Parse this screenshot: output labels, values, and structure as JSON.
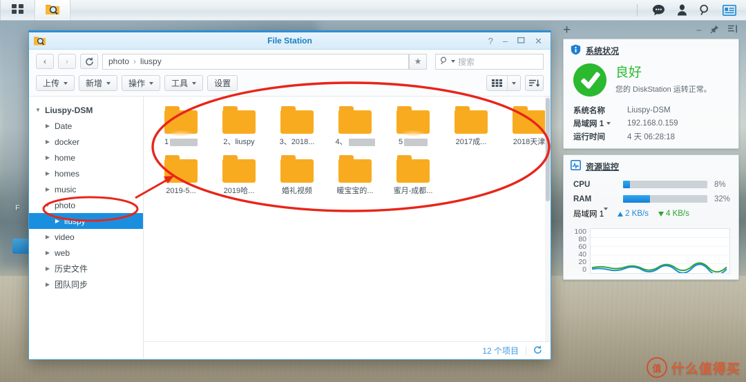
{
  "taskbar": {
    "apps": [
      {
        "name": "main-menu",
        "icon": "grid-menu-icon"
      },
      {
        "name": "file-station",
        "icon": "file-station-icon",
        "active": true
      }
    ],
    "tray": [
      {
        "name": "notifications",
        "icon": "chat-bubble-icon"
      },
      {
        "name": "user-options",
        "icon": "person-icon"
      },
      {
        "name": "search",
        "icon": "search-icon"
      },
      {
        "name": "widgets",
        "icon": "widget-panel-icon"
      }
    ]
  },
  "desktop": {
    "icon_label": "F"
  },
  "file_station": {
    "title": "File Station",
    "window_buttons": {
      "help": "?",
      "minimize": "–",
      "maximize": "❐",
      "close": "✕"
    },
    "nav": {
      "back": "‹",
      "forward": "›",
      "refresh": "⟳",
      "breadcrumb": [
        "photo",
        "liuspy"
      ],
      "breadcrumb_separator": "›",
      "favorite_icon": "star-icon"
    },
    "search": {
      "placeholder": "搜索",
      "value": "",
      "icon": "search-icon"
    },
    "toolbar": {
      "upload": "上传",
      "new": "新增",
      "action": "操作",
      "tools": "工具",
      "settings": "设置",
      "view_mode": "grid-view-icon",
      "view_dropdown": "chevron-down-icon",
      "sort": "sort-icon"
    },
    "tree": [
      {
        "label": "Liuspy-DSM",
        "level": 0,
        "expanded": true,
        "selected": false
      },
      {
        "label": "Date",
        "level": 1,
        "expanded": false,
        "selected": false
      },
      {
        "label": "docker",
        "level": 1,
        "expanded": false,
        "selected": false
      },
      {
        "label": "home",
        "level": 1,
        "expanded": false,
        "selected": false
      },
      {
        "label": "homes",
        "level": 1,
        "expanded": false,
        "selected": false
      },
      {
        "label": "music",
        "level": 1,
        "expanded": false,
        "selected": false
      },
      {
        "label": "photo",
        "level": 1,
        "expanded": true,
        "selected": false
      },
      {
        "label": "liuspy",
        "level": 2,
        "expanded": false,
        "selected": true
      },
      {
        "label": "video",
        "level": 1,
        "expanded": false,
        "selected": false
      },
      {
        "label": "web",
        "level": 1,
        "expanded": false,
        "selected": false
      },
      {
        "label": "历史文件",
        "level": 1,
        "expanded": false,
        "selected": false
      },
      {
        "label": "团队同步",
        "level": 1,
        "expanded": false,
        "selected": false
      }
    ],
    "items": [
      {
        "prefix": "1",
        "label": "",
        "redacted": true,
        "redact_width": 40
      },
      {
        "prefix": "",
        "label": "2、liuspy",
        "redacted": false
      },
      {
        "prefix": "",
        "label": "3、2018...",
        "redacted": false
      },
      {
        "prefix": "4、",
        "label": "",
        "redacted": true,
        "redact_width": 38
      },
      {
        "prefix": "5",
        "label": "",
        "redacted": true,
        "redact_width": 34
      },
      {
        "prefix": "",
        "label": "2017成...",
        "redacted": false
      },
      {
        "prefix": "",
        "label": "2018天津",
        "redacted": false
      },
      {
        "prefix": "",
        "label": "2019-5...",
        "redacted": false
      },
      {
        "prefix": "",
        "label": "2019哈...",
        "redacted": false
      },
      {
        "prefix": "",
        "label": "婚礼视频",
        "redacted": false
      },
      {
        "prefix": "",
        "label": "暖宝宝的...",
        "redacted": false
      },
      {
        "prefix": "",
        "label": "蜜月-成都...",
        "redacted": false
      }
    ],
    "status": {
      "count_text": "12 个项目",
      "refresh_icon": "refresh-icon"
    }
  },
  "widgets": {
    "header": {
      "add": "+",
      "minimize": "–",
      "pin": "pin-icon",
      "collapse": "collapse-icon"
    },
    "system_health": {
      "title": "系统状况",
      "icon": "info-shield-icon",
      "state": "良好",
      "state_color": "#2bb930",
      "message": "您的 DiskStation 运转正常。",
      "rows": [
        {
          "key": "系统名称",
          "value": "Liuspy-DSM",
          "dropdown": false
        },
        {
          "key": "局域网 1",
          "value": "192.168.0.159",
          "dropdown": true
        },
        {
          "key": "运行时间",
          "value": "4 天 06:28:18",
          "dropdown": false
        }
      ]
    },
    "resource_monitor": {
      "title": "资源监控",
      "icon": "resource-monitor-icon",
      "cpu": {
        "label": "CPU",
        "percent": 8,
        "text": "8%"
      },
      "ram": {
        "label": "RAM",
        "percent": 32,
        "text": "32%"
      },
      "network": {
        "label": "局域网 1",
        "dropdown": true,
        "upload": "2 KB/s",
        "download": "4 KB/s"
      },
      "chart": {
        "y_ticks": [
          "100",
          "80",
          "60",
          "40",
          "20",
          "0"
        ],
        "series": [
          {
            "name": "upload",
            "color": "#1e8bd8"
          },
          {
            "name": "download",
            "color": "#2aa52e"
          }
        ]
      }
    }
  },
  "annotations": {
    "ellipse_items": "red-ellipse-around-folder-grid",
    "ellipse_tree": "red-ellipse-around-liuspy-node",
    "arrow": "red-arrow-pointing-to-first-folder",
    "color": "#e8251a"
  },
  "watermark": {
    "seal": "值",
    "text": "什么值得买"
  }
}
